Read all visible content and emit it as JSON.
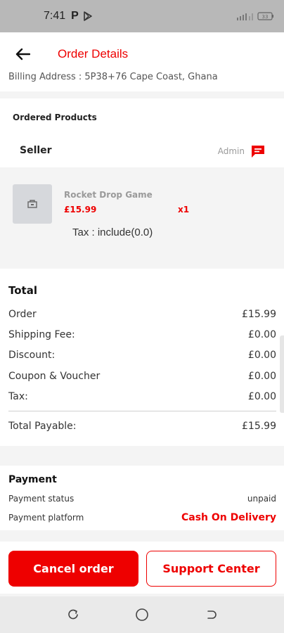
{
  "status_bar": {
    "time": "7:41",
    "p_icon": "P",
    "battery": "33"
  },
  "header": {
    "title": "Order Details",
    "back_icon": "arrow-left-icon"
  },
  "billing": {
    "text": "Billing Address : 5P38+76 Cape Coast, Ghana"
  },
  "ordered_products": {
    "label": "Ordered Products"
  },
  "seller": {
    "label": "Seller",
    "name": "Admin",
    "chat_icon": "chat-icon"
  },
  "product": {
    "name": "Rocket Drop Game",
    "price": "£15.99",
    "qty": "x1",
    "tax": "Tax :  include(0.0)"
  },
  "totals": {
    "title": "Total",
    "rows": [
      {
        "label": "Order",
        "value": "£15.99"
      },
      {
        "label": "Shipping Fee:",
        "value": "£0.00"
      },
      {
        "label": "Discount:",
        "value": "£0.00"
      },
      {
        "label": "Coupon & Voucher",
        "value": "£0.00"
      },
      {
        "label": "Tax:",
        "value": "£0.00"
      }
    ],
    "payable_label": "Total Payable:",
    "payable_value": "£15.99"
  },
  "payment": {
    "title": "Payment",
    "status_label": "Payment status",
    "status_value": "unpaid",
    "platform_label": "Payment platform",
    "platform_value": "Cash On Delivery"
  },
  "actions": {
    "cancel": "Cancel order",
    "support": "Support Center"
  },
  "colors": {
    "accent": "#ee0000",
    "status_bar": "#b8b8b8"
  }
}
